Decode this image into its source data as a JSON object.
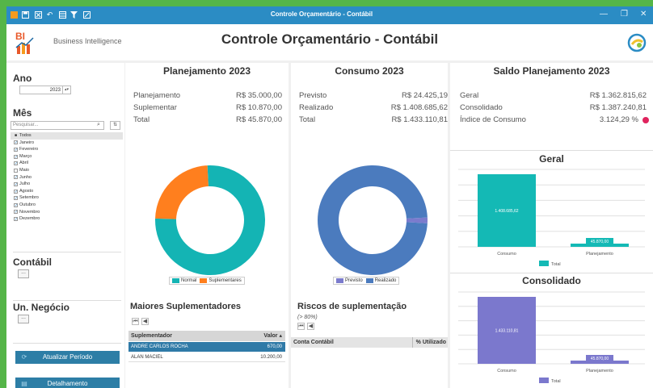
{
  "window": {
    "title": "Controle Orçamentário - Contábil"
  },
  "header": {
    "app_name": "Business Intelligence",
    "logo_text": "BI",
    "title": "Controle Orçamentário - Contábil"
  },
  "sidebar": {
    "ano": {
      "label": "Ano",
      "value": "2023"
    },
    "mes": {
      "label": "Mês",
      "search_placeholder": "Pesquisar...",
      "items": [
        {
          "label": "Todos",
          "checked": "■"
        },
        {
          "label": "Janeiro",
          "checked": "✓"
        },
        {
          "label": "Fevereiro",
          "checked": "✓"
        },
        {
          "label": "Março",
          "checked": "✓"
        },
        {
          "label": "Abril",
          "checked": "✓"
        },
        {
          "label": "Maio",
          "checked": ""
        },
        {
          "label": "Junho",
          "checked": "✓"
        },
        {
          "label": "Julho",
          "checked": "✓"
        },
        {
          "label": "Agosto",
          "checked": "✓"
        },
        {
          "label": "Setembro",
          "checked": "✓"
        },
        {
          "label": "Outubro",
          "checked": "✓"
        },
        {
          "label": "Novembro",
          "checked": "✓"
        },
        {
          "label": "Dezembro",
          "checked": "✓"
        }
      ]
    },
    "contabil": {
      "label": "Contábil",
      "button": "..."
    },
    "un_negocio": {
      "label": "Un. Negócio",
      "button": "..."
    },
    "buttons": {
      "atualizar": "Atualizar Período",
      "detalhamento": "Detalhamento"
    }
  },
  "planejamento": {
    "title": "Planejamento 2023",
    "rows": [
      {
        "label": "Planejamento",
        "value": "R$ 35.000,00"
      },
      {
        "label": "Suplementar",
        "value": "R$ 10.870,00"
      },
      {
        "label": "Total",
        "value": "R$ 45.870,00"
      }
    ],
    "legend": [
      "Normal",
      "Suplementares"
    ]
  },
  "consumo": {
    "title": "Consumo 2023",
    "rows": [
      {
        "label": "Previsto",
        "value": "R$ 24.425,19"
      },
      {
        "label": "Realizado",
        "value": "R$ 1.408.685,62"
      },
      {
        "label": "Total",
        "value": "R$ 1.433.110,81"
      }
    ],
    "legend": [
      "Previsto",
      "Realizado"
    ]
  },
  "saldo": {
    "title": "Saldo Planejamento 2023",
    "rows": [
      {
        "label": "Geral",
        "value": "R$ 1.362.815,62"
      },
      {
        "label": "Consolidado",
        "value": "R$ 1.387.240,81"
      },
      {
        "label": "Índice de Consumo",
        "value": "3.124,29 %"
      }
    ],
    "geral": {
      "title": "Geral",
      "legend": "Total"
    },
    "consolidado": {
      "title": "Consolidado",
      "legend": "Total"
    }
  },
  "maiores": {
    "title": "Maiores Suplementadores",
    "columns": [
      "Suplementador",
      "Valor"
    ],
    "rows": [
      {
        "name": "ANDRE CARLOS ROCHA",
        "value": "670,00"
      },
      {
        "name": "ALAN MACIEL",
        "value": "10.200,00"
      }
    ]
  },
  "riscos": {
    "title": "Riscos de suplementação",
    "subtitle": "(> 80%)",
    "columns": [
      "Conta Contábil",
      "% Utilizado"
    ]
  },
  "colors": {
    "teal": "#14b4b4",
    "orange": "#ff7f1e",
    "previsto": "#7b7bcd",
    "realizado": "#4b7bbe",
    "bar_geral": "#14b9b5",
    "bar_consolidado": "#7b78cd",
    "alert": "#e0245e"
  },
  "chart_data": [
    {
      "type": "pie",
      "categories": [
        "Normal",
        "Suplementares"
      ],
      "values": [
        35000,
        10870
      ]
    },
    {
      "type": "pie",
      "categories": [
        "Previsto",
        "Realizado"
      ],
      "values": [
        24425.19,
        1408685.62
      ]
    },
    {
      "type": "bar",
      "title": "Geral",
      "categories": [
        "Consumo",
        "Planejamento"
      ],
      "series": [
        {
          "name": "Total",
          "values": [
            1408685.62,
            45870
          ]
        }
      ],
      "data_labels": [
        "1.408.685,62",
        "45.870,00"
      ]
    },
    {
      "type": "bar",
      "title": "Consolidado",
      "categories": [
        "Consumo",
        "Planejamento"
      ],
      "series": [
        {
          "name": "Total",
          "values": [
            1433110.81,
            45870
          ]
        }
      ],
      "data_labels": [
        "1.433.110,81",
        "45.870,00"
      ]
    }
  ]
}
